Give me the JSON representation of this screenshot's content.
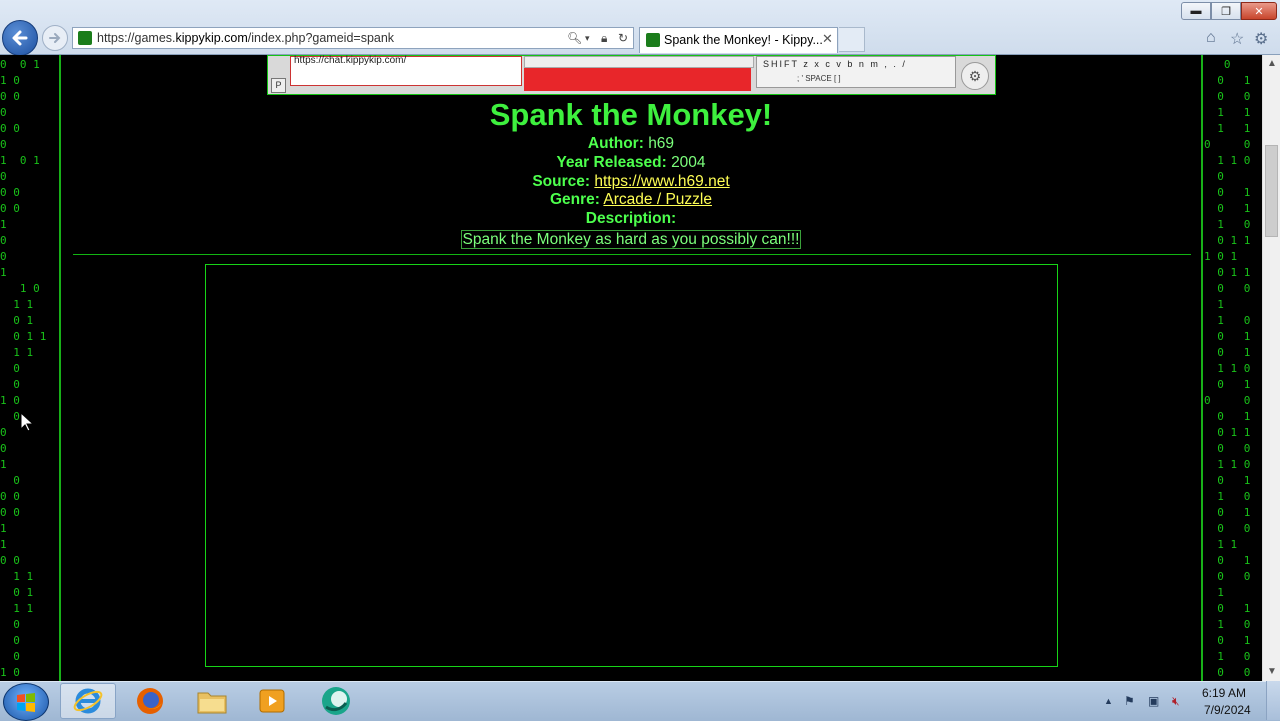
{
  "browser": {
    "url_prefix": "https://games.",
    "url_domain": "kippykip.com",
    "url_suffix": "/index.php?gameid=spank",
    "tab_title": "Spank the Monkey! - Kippy...",
    "tab_close": "✕"
  },
  "top_panel": {
    "chat_url": "https://chat.kippykip.com/",
    "p_button": "P",
    "kb_row1": "SHIFT z x c v b n m , . /",
    "kb_row2": "; '  SPACE  [ ]"
  },
  "game": {
    "title": "Spank the Monkey!",
    "author_label": "Author:",
    "author": "h69",
    "year_label": "Year Released:",
    "year": "2004",
    "source_label": "Source:",
    "source": "https://www.h69.net",
    "genre_label": "Genre:",
    "genre": "Arcade / Puzzle",
    "description_label": "Description:",
    "description": "Spank the Monkey as hard as you possibly can!!!"
  },
  "taskbar": {
    "time": "6:19 AM",
    "date": "7/9/2024"
  },
  "icons": {
    "back": "back-arrow-icon",
    "forward": "forward-arrow-icon",
    "search": "search-icon",
    "lock": "lock-icon",
    "refresh": "refresh-icon",
    "home": "home-icon",
    "favorites": "star-icon",
    "settings": "gear-icon"
  },
  "colors": {
    "page_bg": "#000000",
    "matrix_green": "#19c219",
    "title_green": "#3ef03e",
    "link_yellow": "#ffff55"
  }
}
